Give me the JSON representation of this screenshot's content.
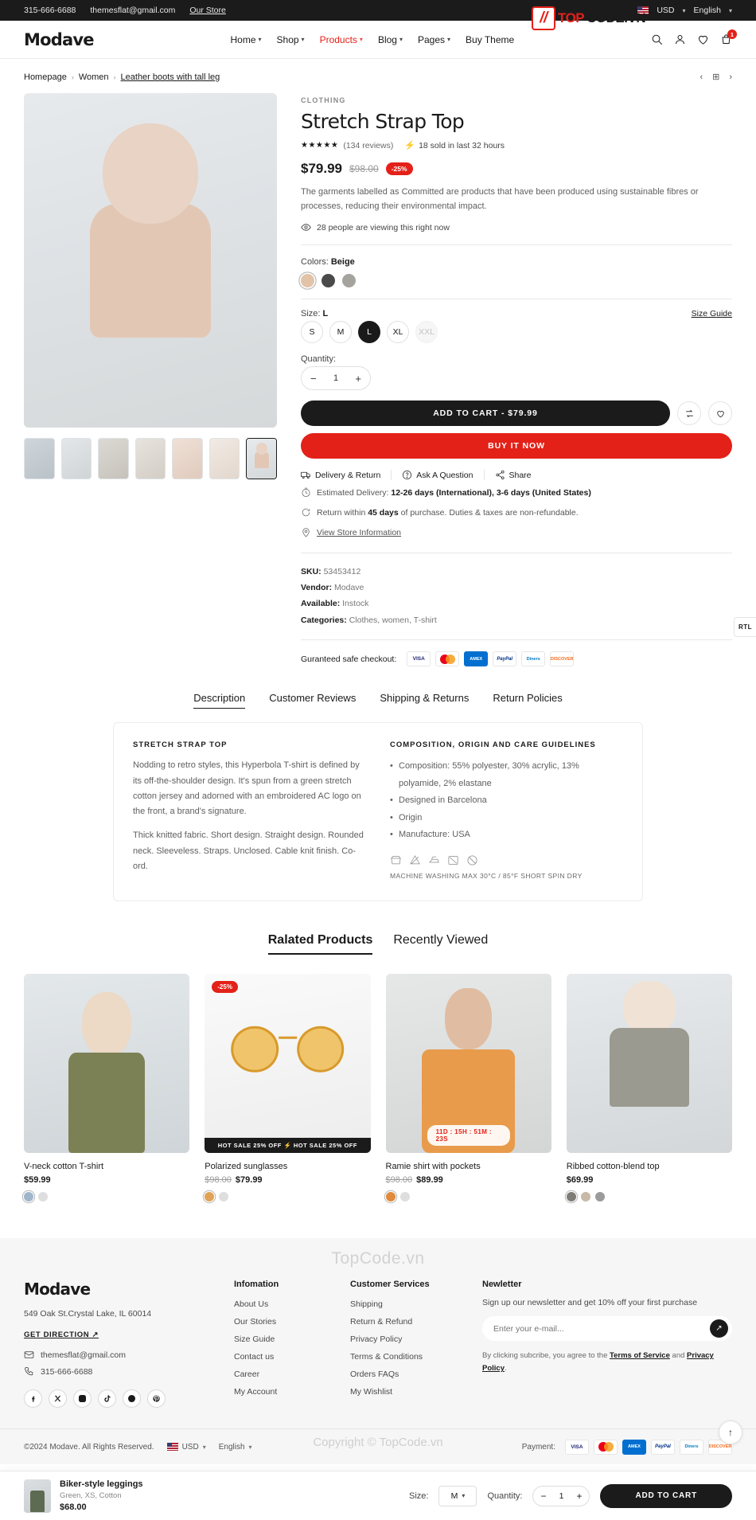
{
  "topbar": {
    "phone": "315-666-6688",
    "email": "themesflat@gmail.com",
    "store_link": "Our Store",
    "currency": "USD",
    "language": "English"
  },
  "watermark": {
    "mark": "//",
    "top": "TOP",
    "code": "CODE.VN",
    "footer_logo": "TopCode.vn",
    "copyright": "Copyright © TopCode.vn"
  },
  "header": {
    "logo": "Modave",
    "nav": [
      {
        "label": "Home",
        "has_caret": true,
        "active": false
      },
      {
        "label": "Shop",
        "has_caret": true,
        "active": false
      },
      {
        "label": "Products",
        "has_caret": true,
        "active": true
      },
      {
        "label": "Blog",
        "has_caret": true,
        "active": false
      },
      {
        "label": "Pages",
        "has_caret": true,
        "active": false
      },
      {
        "label": "Buy Theme",
        "has_caret": false,
        "active": false
      }
    ],
    "cart_count": "1"
  },
  "breadcrumb": {
    "items": [
      "Homepage",
      "Women",
      "Leather boots with tall leg"
    ]
  },
  "product": {
    "eyebrow": "CLOTHING",
    "title": "Stretch Strap Top",
    "stars": "★★★★★",
    "reviews": "(134 reviews)",
    "sold": "18 sold in last 32 hours",
    "price": "$79.99",
    "old_price": "$98.00",
    "discount": "-25%",
    "description": "The garments labelled as Committed are products that have been produced using sustainable fibres or processes, reducing their environmental impact.",
    "viewers": "28 people are viewing this right now",
    "colors_label": "Colors:",
    "color_selected": "Beige",
    "colors": [
      {
        "name": "Beige",
        "hex": "#e3c3a8",
        "selected": true
      },
      {
        "name": "Dark Grey",
        "hex": "#4a4a4a",
        "selected": false
      },
      {
        "name": "Grey",
        "hex": "#a5a39e",
        "selected": false
      }
    ],
    "size_label": "Size:",
    "size_selected": "L",
    "size_guide": "Size Guide",
    "sizes": [
      {
        "label": "S",
        "selected": false,
        "disabled": false
      },
      {
        "label": "M",
        "selected": false,
        "disabled": false
      },
      {
        "label": "L",
        "selected": true,
        "disabled": false
      },
      {
        "label": "XL",
        "selected": false,
        "disabled": false
      },
      {
        "label": "XXL",
        "selected": false,
        "disabled": true
      }
    ],
    "quantity_label": "Quantity:",
    "quantity": "1",
    "add_to_cart": "ADD TO CART - $79.99",
    "buy_now": "BUY IT NOW",
    "links": [
      {
        "label": "Delivery & Return",
        "icon": "truck-icon"
      },
      {
        "label": "Ask A Question",
        "icon": "question-icon"
      },
      {
        "label": "Share",
        "icon": "share-icon"
      }
    ],
    "delivery_label": "Estimated Delivery:",
    "delivery_value": "12-26 days (International), 3-6 days (United States)",
    "return_text_1": "Return within",
    "return_days": "45 days",
    "return_text_2": "of purchase. Duties & taxes are non-refundable.",
    "store_info": "View Store Information",
    "sku_label": "SKU:",
    "sku_value": "53453412",
    "vendor_label": "Vendor:",
    "vendor_value": "Modave",
    "available_label": "Available:",
    "available_value": "Instock",
    "categories_label": "Categories:",
    "categories_value": "Clothes, women, T-shirt",
    "checkout_label": "Guranteed safe checkout:",
    "payment_cards": [
      "VISA",
      "mastercard",
      "AMEX",
      "PayPal",
      "Diners",
      "DISCOVER"
    ]
  },
  "tabs": {
    "items": [
      {
        "label": "Description",
        "active": true
      },
      {
        "label": "Customer Reviews",
        "active": false
      },
      {
        "label": "Shipping & Returns",
        "active": false
      },
      {
        "label": "Return Policies",
        "active": false
      }
    ],
    "left_heading": "STRETCH STRAP TOP",
    "left_p1": "Nodding to retro styles, this Hyperbola T-shirt is defined by its off-the-shoulder design. It's spun from a green stretch cotton jersey and adorned with an embroidered AC logo on the front, a brand's signature.",
    "left_p2": "Thick knitted fabric. Short design. Straight design. Rounded neck. Sleeveless. Straps. Unclosed. Cable knit finish. Co-ord.",
    "right_heading": "COMPOSITION, ORIGIN AND CARE GUIDELINES",
    "right_items": [
      "Composition: 55% polyester, 30% acrylic, 13% polyamide, 2% elastane",
      "Designed in Barcelona",
      "Origin",
      "Manufacture: USA"
    ],
    "care_note": "MACHINE WASHING MAX 30°C / 85°F SHORT SPIN DRY"
  },
  "related": {
    "tabs": [
      {
        "label": "Ralated Products",
        "active": true
      },
      {
        "label": "Recently Viewed",
        "active": false
      }
    ],
    "products": [
      {
        "name": "V-neck cotton T-shirt",
        "price": "$59.99",
        "old_price": "",
        "badge": "",
        "overlay": "",
        "overlay_type": "",
        "image_class": "pg-green",
        "swatches": [
          {
            "hex": "#9fb6cc",
            "selected": true
          },
          {
            "hex": "#dedede",
            "selected": false
          }
        ]
      },
      {
        "name": "Polarized sunglasses",
        "price": "$79.99",
        "old_price": "$98.00",
        "badge": "-25%",
        "overlay": "HOT SALE 25% OFF  ⚡  HOT SALE 25% OFF",
        "overlay_type": "hotsale",
        "image_class": "pg-sun",
        "swatches": [
          {
            "hex": "#e0a355",
            "selected": true
          },
          {
            "hex": "#dedede",
            "selected": false
          }
        ]
      },
      {
        "name": "Ramie shirt with pockets",
        "price": "$89.99",
        "old_price": "$98.00",
        "badge": "",
        "overlay": "11D : 15H : 51M : 23S",
        "overlay_type": "countdown",
        "image_class": "pg-orange",
        "swatches": [
          {
            "hex": "#e08b3c",
            "selected": true
          },
          {
            "hex": "#dedede",
            "selected": false
          }
        ]
      },
      {
        "name": "Ribbed cotton-blend top",
        "price": "$69.99",
        "old_price": "",
        "badge": "",
        "overlay": "",
        "overlay_type": "",
        "image_class": "pg-ribbed",
        "swatches": [
          {
            "hex": "#7d7d75",
            "selected": true
          },
          {
            "hex": "#c8b9a9",
            "selected": false
          },
          {
            "hex": "#9b9b9b",
            "selected": false
          }
        ]
      }
    ]
  },
  "footer": {
    "logo": "Modave",
    "address": "549 Oak St.Crystal Lake, IL 60014",
    "get_direction": "GET DIRECTION",
    "email": "themesflat@gmail.com",
    "phone": "315-666-6688",
    "socials": [
      "facebook-icon",
      "x-icon",
      "instagram-icon",
      "tiktok-icon",
      "threads-icon",
      "pinterest-icon"
    ],
    "col1_title": "Infomation",
    "col1_links": [
      "About Us",
      "Our Stories",
      "Size Guide",
      "Contact us",
      "Career",
      "My Account"
    ],
    "col2_title": "Customer Services",
    "col2_links": [
      "Shipping",
      "Return & Refund",
      "Privacy Policy",
      "Terms & Conditions",
      "Orders FAQs",
      "My Wishlist"
    ],
    "news_title": "Newletter",
    "news_sub": "Sign up our newsletter and get 10% off your first purchase",
    "news_placeholder": "Enter your e-mail...",
    "news_tiny_1": "By clicking subcribe, you agree to the",
    "news_tiny_terms": "Terms of Service",
    "news_tiny_and": "and",
    "news_tiny_privacy": "Privacy Policy",
    "copyright": "©2024 Modave. All Rights Reserved.",
    "currency": "USD",
    "language": "English",
    "payment_label": "Payment:",
    "payment_cards": [
      "VISA",
      "mastercard",
      "AMEX",
      "PayPal",
      "Diners",
      "DISCOVER"
    ]
  },
  "floating": {
    "rtl": "RTL",
    "to_top": "↑"
  },
  "sticky": {
    "name": "Biker-style leggings",
    "variant": "Green, XS, Cotton",
    "price": "$68.00",
    "size_label": "Size:",
    "size_value": "M",
    "quantity_label": "Quantity:",
    "quantity": "1",
    "add_to_cart": "ADD TO CART"
  }
}
